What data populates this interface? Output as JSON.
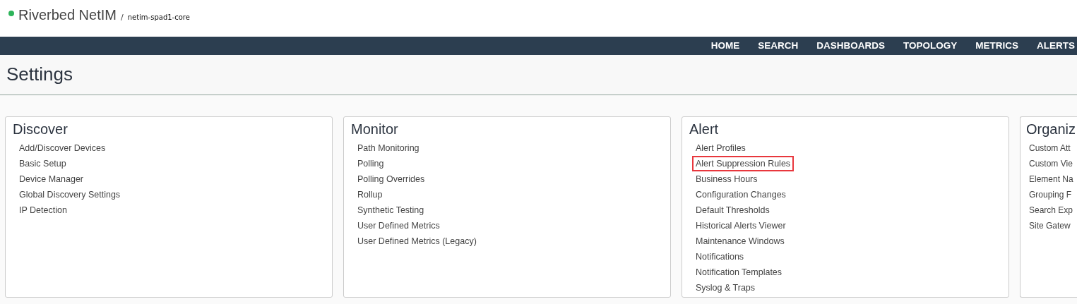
{
  "header": {
    "online": true,
    "app_name": "Riverbed NetIM",
    "separator": "/",
    "host": "netim-spad1-core"
  },
  "nav": {
    "items": [
      {
        "label": "HOME",
        "selected": false
      },
      {
        "label": "SEARCH",
        "selected": false
      },
      {
        "label": "DASHBOARDS",
        "selected": false
      },
      {
        "label": "TOPOLOGY",
        "selected": false
      },
      {
        "label": "METRICS",
        "selected": false
      },
      {
        "label": "ALERTS",
        "selected": false
      }
    ]
  },
  "page_title": "Settings",
  "cards": [
    {
      "title": "Discover",
      "links": [
        {
          "label": "Add/Discover Devices",
          "highlighted": false
        },
        {
          "label": "Basic Setup",
          "highlighted": false
        },
        {
          "label": "Device Manager",
          "highlighted": false
        },
        {
          "label": "Global Discovery Settings",
          "highlighted": false
        },
        {
          "label": "IP Detection",
          "highlighted": false
        }
      ]
    },
    {
      "title": "Monitor",
      "links": [
        {
          "label": "Path Monitoring",
          "highlighted": false
        },
        {
          "label": "Polling",
          "highlighted": false
        },
        {
          "label": "Polling Overrides",
          "highlighted": false
        },
        {
          "label": "Rollup",
          "highlighted": false
        },
        {
          "label": "Synthetic Testing",
          "highlighted": false
        },
        {
          "label": "User Defined Metrics",
          "highlighted": false
        },
        {
          "label": "User Defined Metrics (Legacy)",
          "highlighted": false
        }
      ]
    },
    {
      "title": "Alert",
      "links": [
        {
          "label": "Alert Profiles",
          "highlighted": false
        },
        {
          "label": "Alert Suppression Rules",
          "highlighted": true
        },
        {
          "label": "Business Hours",
          "highlighted": false
        },
        {
          "label": "Configuration Changes",
          "highlighted": false
        },
        {
          "label": "Default Thresholds",
          "highlighted": false
        },
        {
          "label": "Historical Alerts Viewer",
          "highlighted": false
        },
        {
          "label": "Maintenance Windows",
          "highlighted": false
        },
        {
          "label": "Notifications",
          "highlighted": false
        },
        {
          "label": "Notification Templates",
          "highlighted": false
        },
        {
          "label": "Syslog & Traps",
          "highlighted": false
        }
      ]
    },
    {
      "title": "Organiz",
      "links": [
        {
          "label": "Custom Att",
          "highlighted": false
        },
        {
          "label": "Custom Vie",
          "highlighted": false
        },
        {
          "label": "Element Na",
          "highlighted": false
        },
        {
          "label": "Grouping F",
          "highlighted": false
        },
        {
          "label": "Search Exp",
          "highlighted": false
        },
        {
          "label": "Site Gatew",
          "highlighted": false
        }
      ]
    }
  ]
}
